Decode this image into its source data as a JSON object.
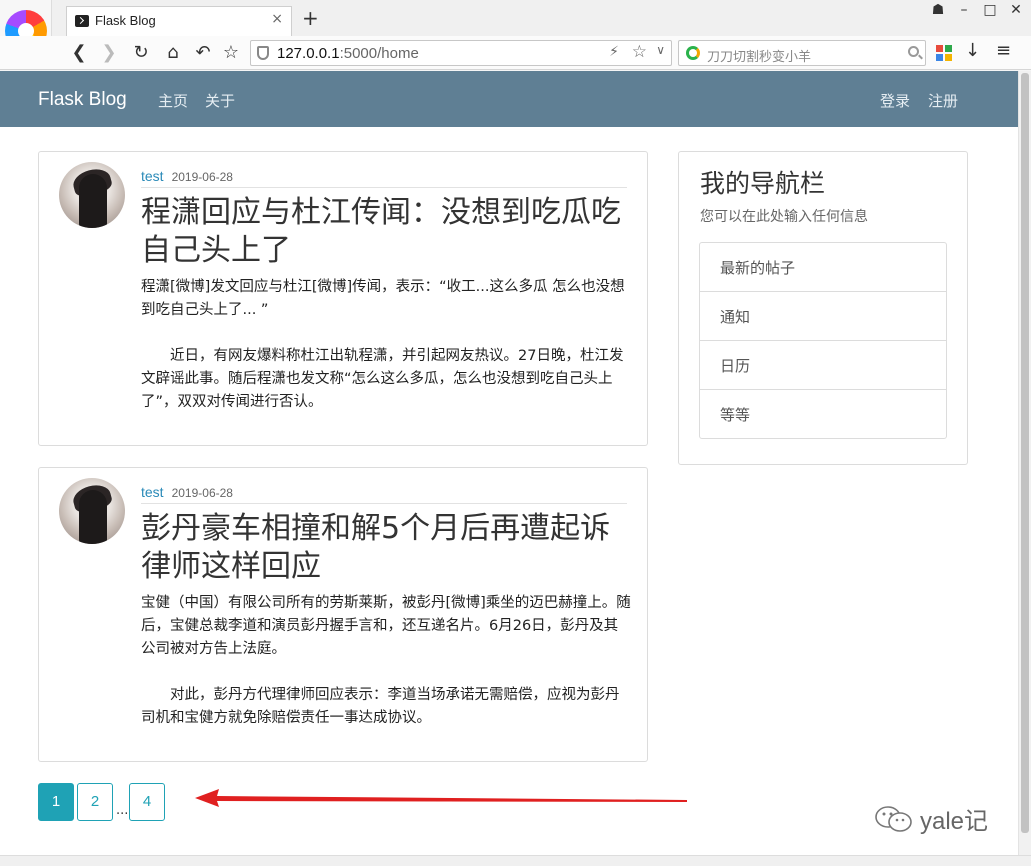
{
  "browser": {
    "tab_title": "Flask Blog",
    "tab_close": "×",
    "new_tab": "+",
    "url_host": "127.0.0.1",
    "url_path": ":5000/home",
    "search_placeholder": "刀刀切割秒变小羊",
    "win_controls": [
      "☗",
      "–",
      "□",
      "✕"
    ]
  },
  "site": {
    "brand": "Flask Blog",
    "nav_left": [
      "主页",
      "关于"
    ],
    "nav_right": [
      "登录",
      "注册"
    ]
  },
  "posts": [
    {
      "author": "test",
      "date": "2019-06-28",
      "title": "程潇回应与杜江传闻：没想到吃瓜吃自己头上了",
      "paragraphs": [
        "程潇[微博]发文回应与杜江[微博]传闻，表示：“收工...这么多瓜 怎么也没想到吃自己头上了... ”",
        "近日，有网友爆料称杜江出轨程潇，并引起网友热议。27日晚，杜江发文辟谣此事。随后程潇也发文称“怎么这么多瓜，怎么也没想到吃自己头上了”，双双对传闻进行否认。"
      ]
    },
    {
      "author": "test",
      "date": "2019-06-28",
      "title": "彭丹豪车相撞和解5个月后再遭起诉 律师这样回应",
      "paragraphs": [
        "宝健（中国）有限公司所有的劳斯莱斯，被彭丹[微博]乘坐的迈巴赫撞上。随后，宝健总裁李道和演员彭丹握手言和，还互递名片。6月26日，彭丹及其公司被对方告上法庭。",
        "对此，彭丹方代理律师回应表示：李道当场承诺无需赔偿，应视为彭丹司机和宝健方就免除赔偿责任一事达成协议。"
      ]
    }
  ],
  "sidebar": {
    "title": "我的导航栏",
    "subtitle": "您可以在此处输入任何信息",
    "items": [
      "最新的帖子",
      "通知",
      "日历",
      "等等"
    ]
  },
  "pagination": {
    "pages": [
      "1",
      "2",
      "4"
    ],
    "ellipsis": "...",
    "current": "1"
  },
  "watermark": {
    "text": "yale记"
  },
  "colors": {
    "navbar": "#5f7f94",
    "accent": "#1fa2b5",
    "author_link": "#2a8ab8",
    "annotation_arrow": "#e02020"
  }
}
